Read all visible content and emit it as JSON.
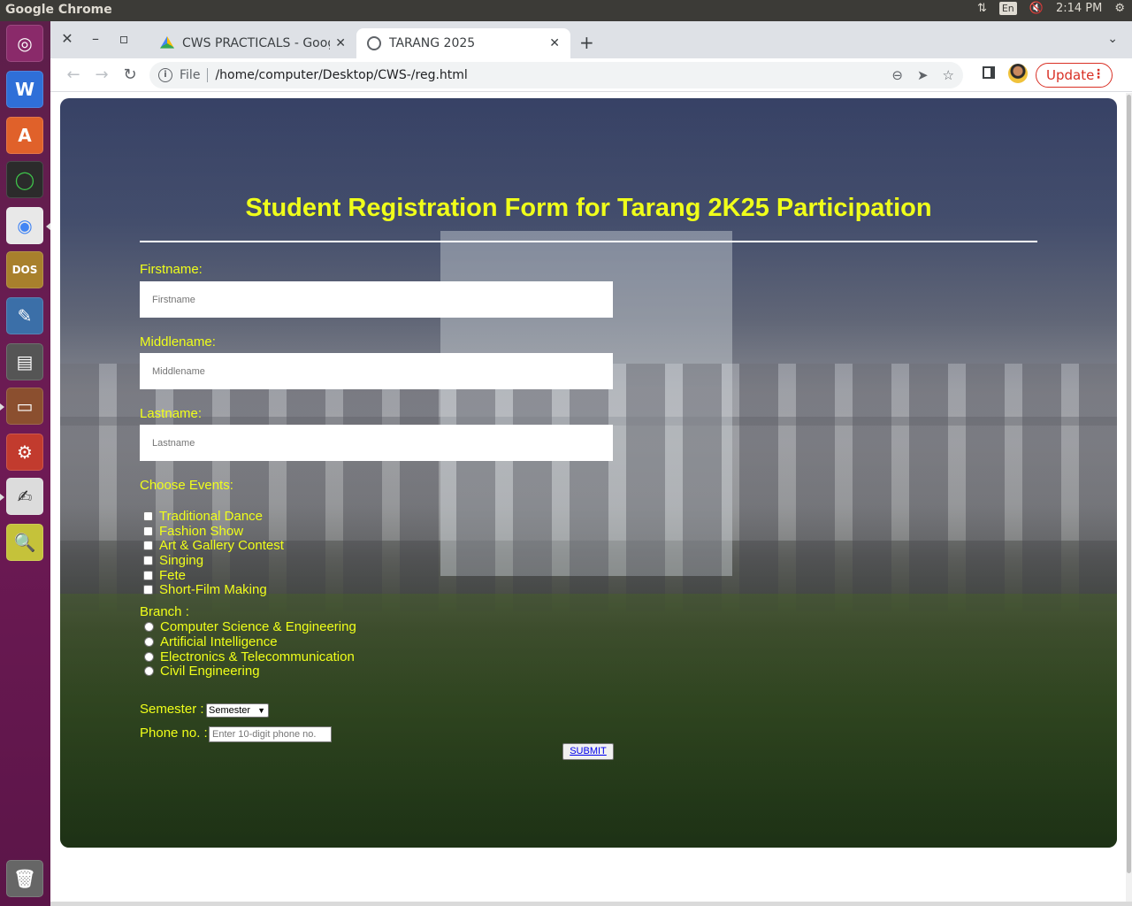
{
  "topbar": {
    "app_title": "Google Chrome",
    "lang": "En",
    "time": "2:14 PM"
  },
  "launcher": {
    "items": [
      "ubuntu-dash-icon",
      "wps-writer-icon",
      "software-center-icon",
      "app-ring-icon",
      "chrome-icon",
      "dosbox-icon",
      "draw-app-icon",
      "save-icon",
      "files-icon",
      "settings-tools-icon",
      "text-editor-icon",
      "document-viewer-icon",
      "trash-icon"
    ]
  },
  "browser": {
    "tabs": [
      {
        "title": "CWS PRACTICALS - Google",
        "close": "✕"
      },
      {
        "title": "TARANG 2025",
        "close": "✕"
      }
    ],
    "new_tab": "+",
    "address": {
      "scheme": "File",
      "url": "/home/computer/Desktop/CWS-/reg.html"
    },
    "update_label": "Update",
    "accent": "#d93025"
  },
  "form": {
    "heading": "Student Registration Form for Tarang 2K25 Participation",
    "firstname_label": "Firstname:",
    "firstname_placeholder": "Firstname",
    "middlename_label": "Middlename:",
    "middlename_placeholder": "Middlename",
    "lastname_label": "Lastname:",
    "lastname_placeholder": "Lastname",
    "events_label": "Choose Events:",
    "events": [
      "Traditional Dance",
      "Fashion Show",
      "Art & Gallery Contest",
      "Singing",
      "Fete",
      "Short-Film Making"
    ],
    "branch_label": "Branch :",
    "branches": [
      "Computer Science & Engineering",
      "Artificial Intelligence",
      "Electronics & Telecommunication",
      "Civil Engineering"
    ],
    "semester_label": "Semester :",
    "semester_selected": "Semester",
    "phone_label": "Phone no. :",
    "phone_placeholder": "Enter 10-digit phone no.",
    "submit_label": "SUBMIT",
    "text_color": "#f0ff1a"
  }
}
